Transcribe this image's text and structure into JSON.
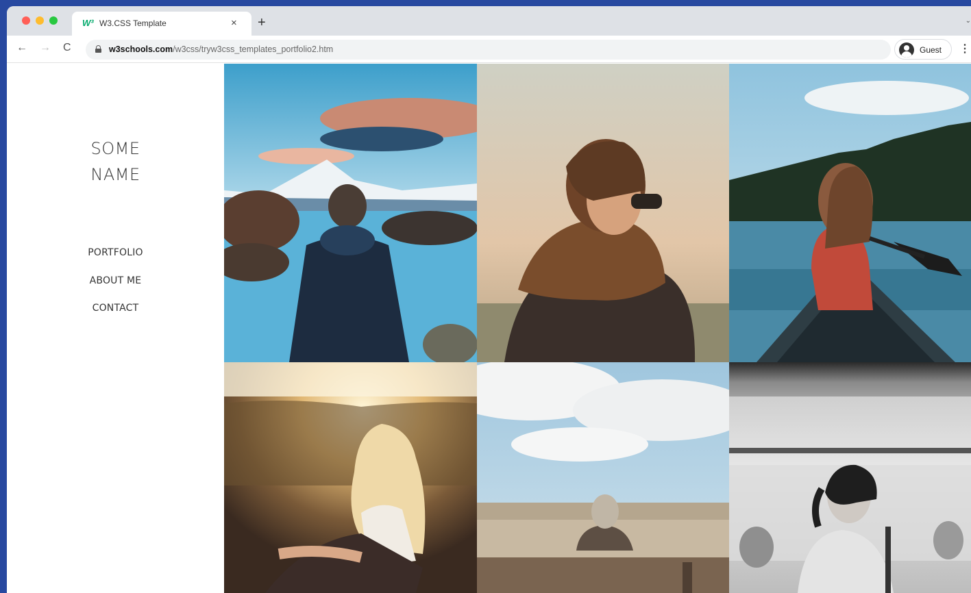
{
  "browser": {
    "tab_title": "W3.CSS Template",
    "tab_favicon": "W³",
    "tab_close": "×",
    "new_tab": "+",
    "tab_menu": "⌄",
    "url_host": "w3schools.com",
    "url_path": "/w3css/tryw3css_templates_portfolio2.htm",
    "profile_label": "Guest",
    "icons": {
      "back": "←",
      "forward": "→",
      "reload": "C",
      "menu": "⋮"
    },
    "traffic_colors": [
      "#ff5f57",
      "#febc2e",
      "#28c840"
    ]
  },
  "site": {
    "name_line1": "SOME",
    "name_line2": "NAME",
    "nav": [
      {
        "label": "PORTFOLIO"
      },
      {
        "label": "ABOUT ME"
      },
      {
        "label": "CONTACT"
      }
    ]
  },
  "gallery": {
    "photos": [
      {
        "subject": "man-in-jacket-at-mountain-lake"
      },
      {
        "subject": "person-with-scarf-and-sunglasses"
      },
      {
        "subject": "woman-in-canoe-on-lake"
      },
      {
        "subject": "blonde-woman-in-sunlight"
      },
      {
        "subject": "elderly-person-on-bench"
      },
      {
        "subject": "woman-in-subway-blur"
      }
    ]
  },
  "colors": {
    "desktop_background": "#2849a0",
    "accent_w3": "#04aa6d"
  }
}
